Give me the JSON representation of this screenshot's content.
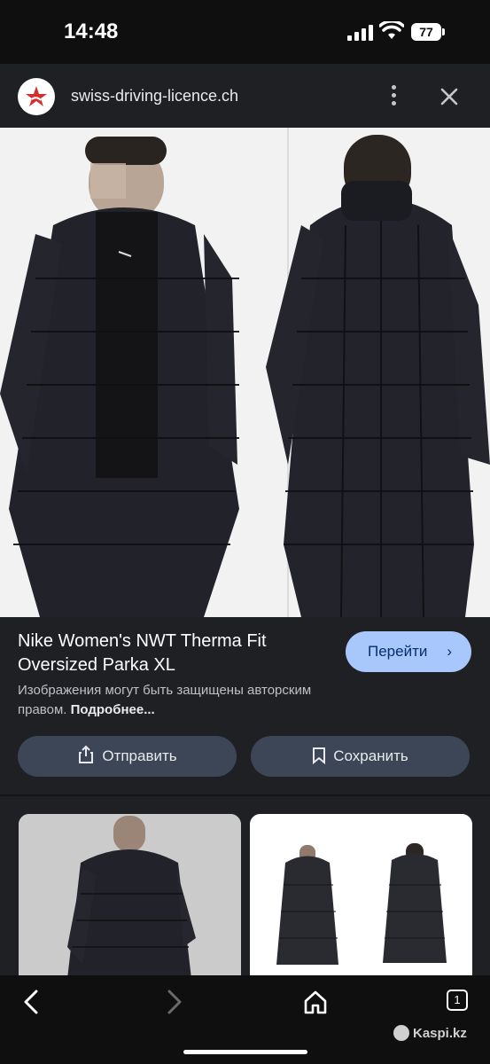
{
  "status_bar": {
    "time": "14:48",
    "battery": "77"
  },
  "header": {
    "site": "swiss-driving-licence.ch"
  },
  "product": {
    "title": "Nike Women's NWT Therma Fit Oversized Parka XL",
    "go_label": "Перейти",
    "copyright": "Изображения могут быть защищены авторским правом.",
    "more_link": "Подробнее...",
    "share_label": "Отправить",
    "save_label": "Сохранить"
  },
  "tabs_count": "1",
  "watermark": "Kaspi.kz",
  "colors": {
    "accent_button": "#a8c7fa",
    "secondary_button": "#3c4656",
    "background": "#1f2023"
  }
}
